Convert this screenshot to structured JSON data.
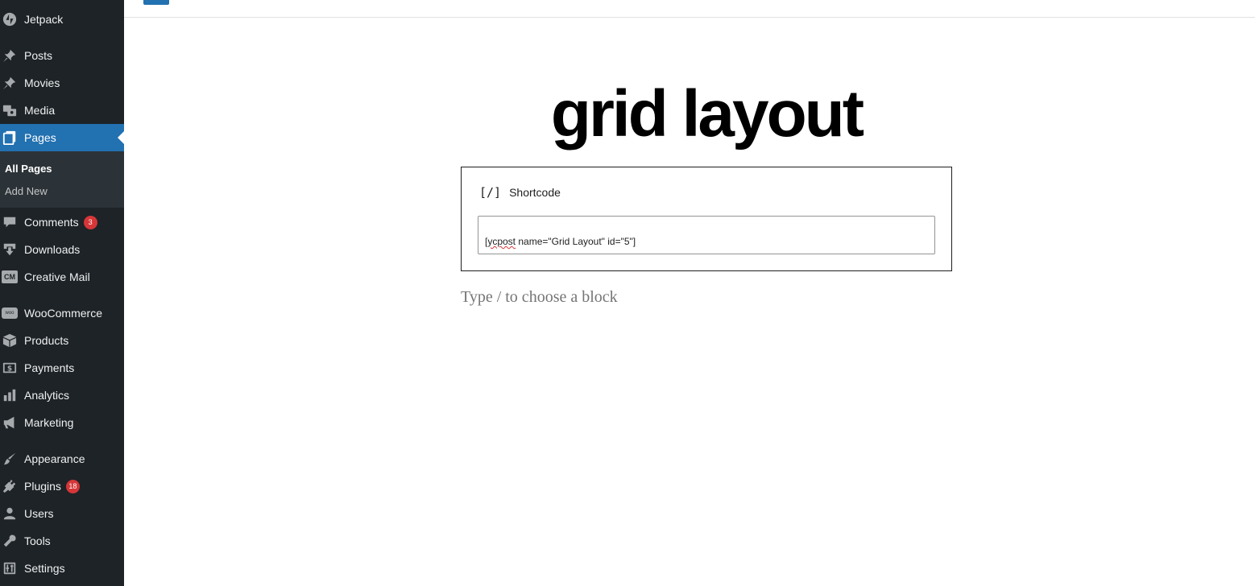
{
  "sidebar": {
    "items": [
      {
        "label": "Jetpack",
        "icon": "jetpack-icon"
      },
      {
        "label": "Posts",
        "icon": "pin-icon"
      },
      {
        "label": "Movies",
        "icon": "pin-icon"
      },
      {
        "label": "Media",
        "icon": "media-icon"
      },
      {
        "label": "Pages",
        "icon": "pages-icon"
      },
      {
        "label": "Comments",
        "icon": "comment-icon",
        "badge": "3"
      },
      {
        "label": "Downloads",
        "icon": "download-icon"
      },
      {
        "label": "Creative Mail",
        "icon": "creative-mail-icon",
        "icon_text": "CM"
      },
      {
        "label": "WooCommerce",
        "icon": "woocommerce-icon",
        "icon_text": "woo"
      },
      {
        "label": "Products",
        "icon": "products-box-icon"
      },
      {
        "label": "Payments",
        "icon": "payments-icon"
      },
      {
        "label": "Analytics",
        "icon": "analytics-bar-icon"
      },
      {
        "label": "Marketing",
        "icon": "megaphone-icon"
      },
      {
        "label": "Appearance",
        "icon": "paintbrush-icon"
      },
      {
        "label": "Plugins",
        "icon": "plugin-icon",
        "badge": "18"
      },
      {
        "label": "Users",
        "icon": "user-icon"
      },
      {
        "label": "Tools",
        "icon": "wrench-icon"
      },
      {
        "label": "Settings",
        "icon": "settings-icon"
      }
    ],
    "submenu": [
      {
        "label": "All Pages",
        "current": true
      },
      {
        "label": "Add New",
        "current": false
      }
    ]
  },
  "editor": {
    "title": "grid layout",
    "shortcode_block": {
      "icon": "[/]",
      "label": "Shortcode",
      "value_misspelled": "[ycpost",
      "value_rest": " name=\"Grid Layout\" id=\"5\"]"
    },
    "appender_placeholder": "Type / to choose a block"
  },
  "colors": {
    "sidebar_bg": "#1d2327",
    "active": "#2271b1",
    "badge": "#d63638"
  }
}
